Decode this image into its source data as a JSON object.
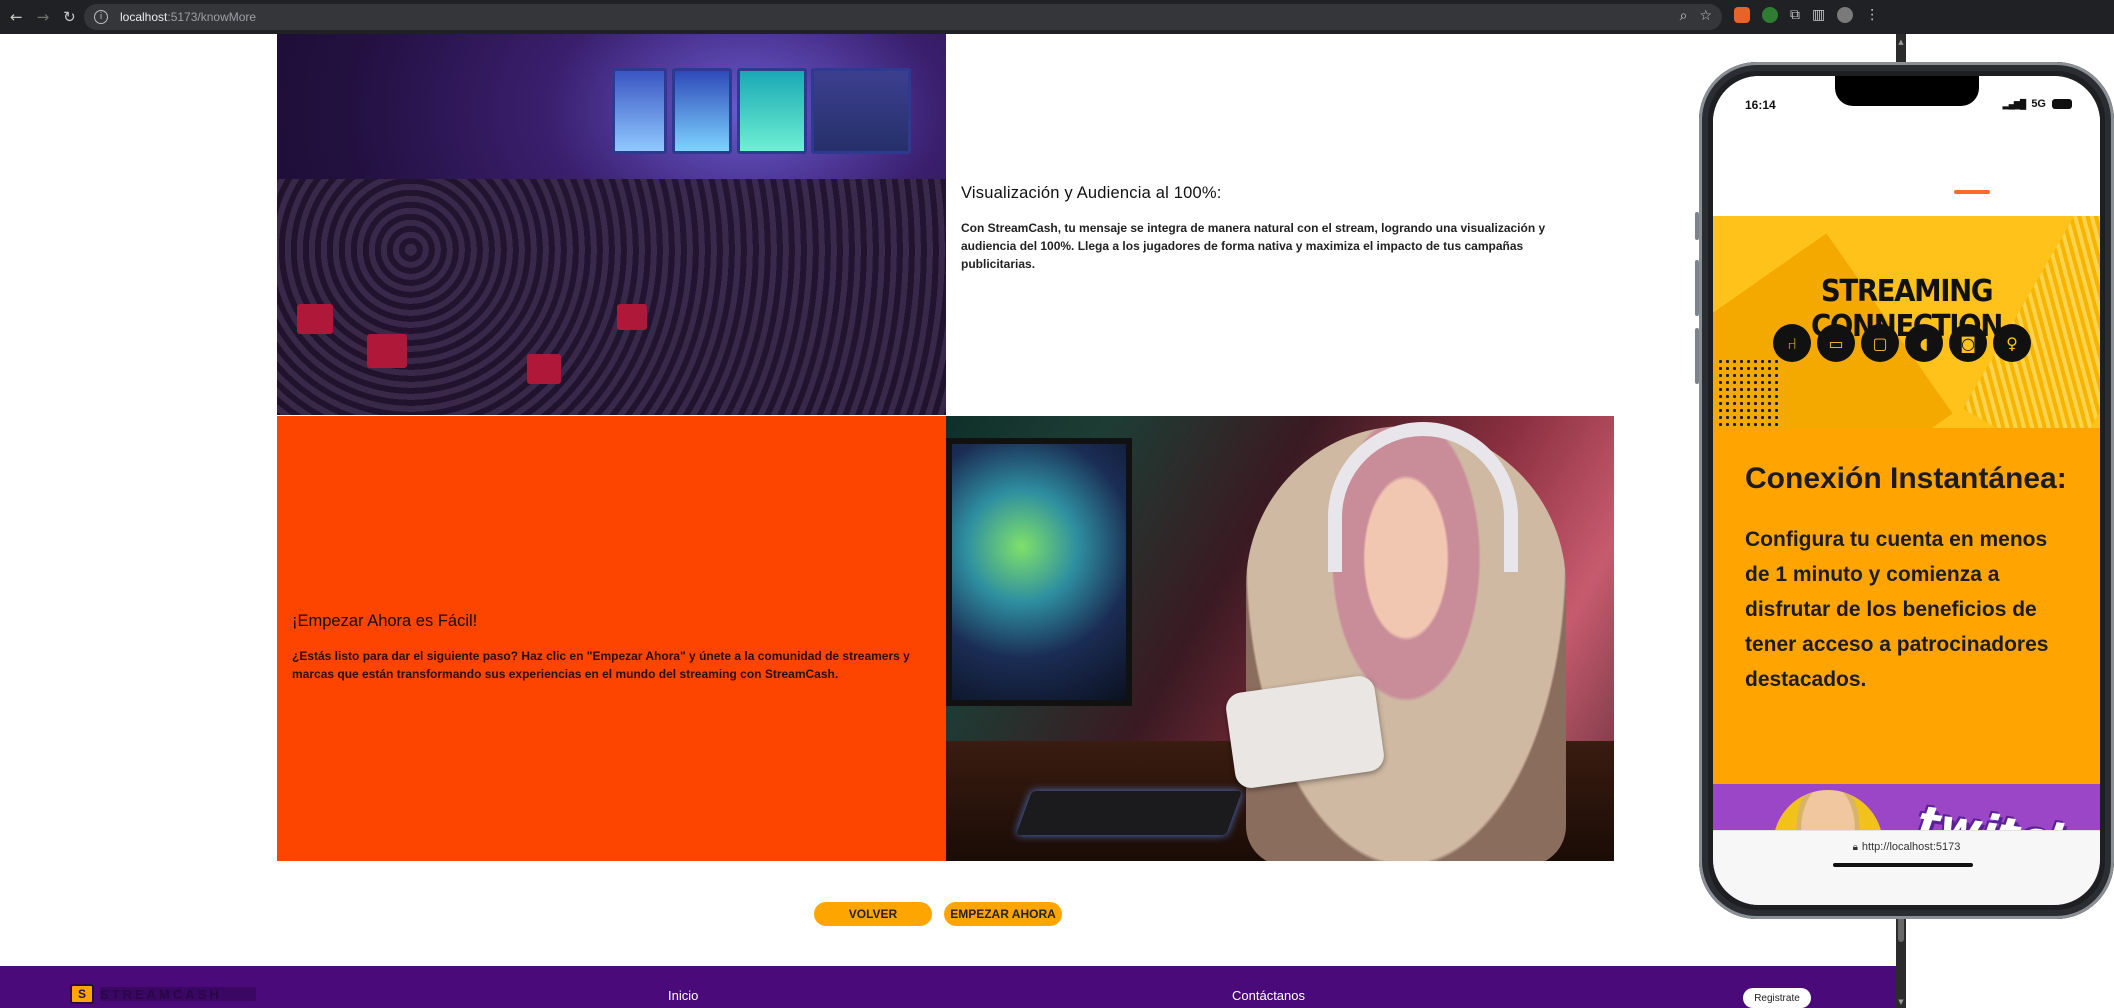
{
  "browser": {
    "url_host": "localhost",
    "url_path": ":5173/knowMore"
  },
  "sections": {
    "audience": {
      "title": "Visualización y Audiencia al 100%:",
      "body": "Con StreamCash, tu mensaje se integra de manera natural con el stream, logrando una visualización y audiencia del 100%. Llega a los jugadores de forma nativa y maximiza el impacto de tus campañas publicitarias."
    },
    "start": {
      "title": "¡Empezar Ahora es Fácil!",
      "body": "¿Estás listo para dar el siguiente paso? Haz clic en \"Empezar Ahora\" y únete a la comunidad de streamers y marcas que están transformando sus experiencias en el mundo del streaming con StreamCash."
    }
  },
  "buttons": {
    "back": "VOLVER",
    "start_now": "EMPEZAR AHORA"
  },
  "footer": {
    "logo_mark": "S",
    "logo_text": "STREAMCASH",
    "links": [
      "Inicio",
      "Contáctanos"
    ],
    "register": "Registrate"
  },
  "phone": {
    "time": "16:14",
    "network": "5G",
    "banner_title": "STREAMING CONNECTION",
    "banner_icons": [
      "chair-icon",
      "laptop-icon",
      "monitor-icon",
      "speaker-icon",
      "camera-icon",
      "microphone-icon"
    ],
    "panel_title": "Conexión Instantánea:",
    "panel_body": "Configura tu cuenta en menos de 1 minuto y comienza a disfrutar de los beneficios de tener acceso a patrocinadores destacados.",
    "twitch_text": "twitch",
    "url": "http://localhost:5173"
  },
  "colors": {
    "orange_block": "#fe4500",
    "button": "#ffa500",
    "footer": "#4a0a7a",
    "phone_banner": "#ffc21a",
    "phone_panel": "#ffa400",
    "twitch_purple": "#9b46c6"
  }
}
